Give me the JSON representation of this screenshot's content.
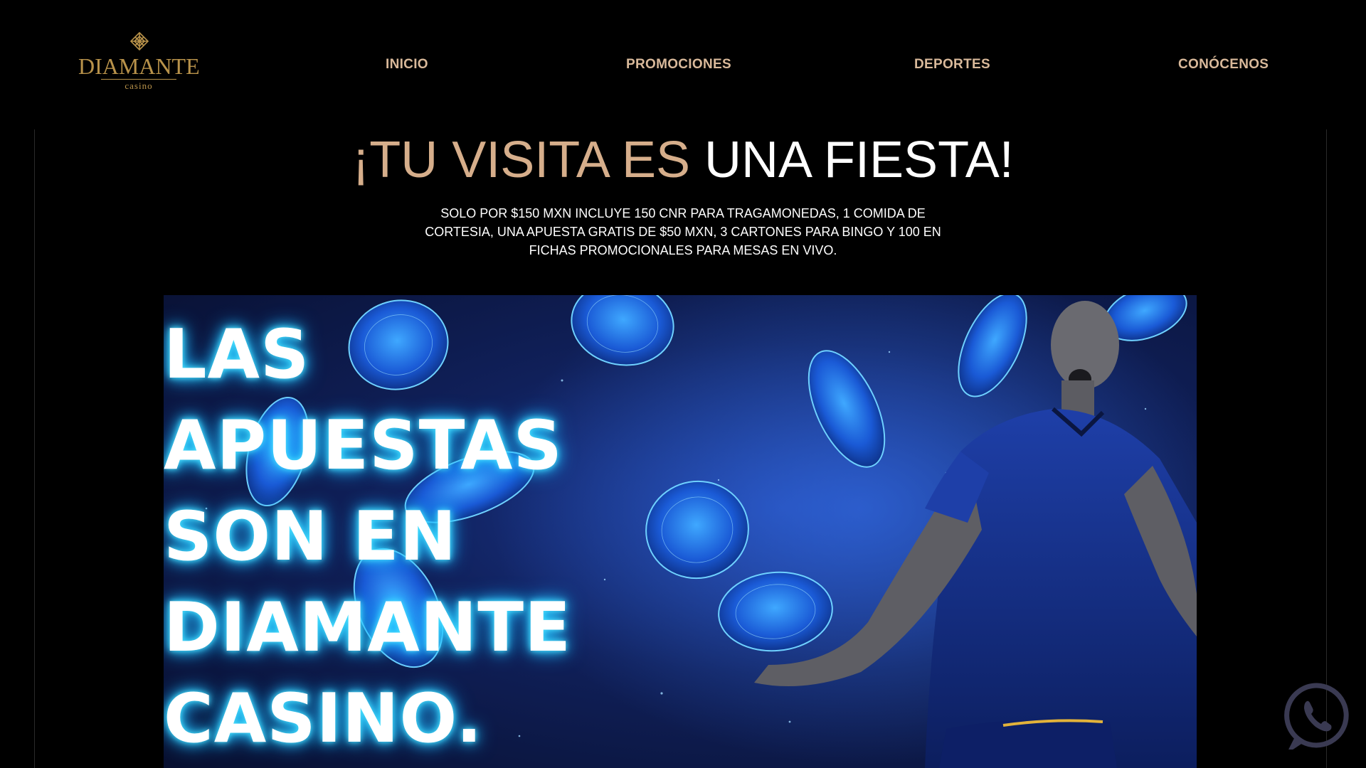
{
  "brand": {
    "name": "DIAMANTE",
    "sub": "casino",
    "gold": "#b8924a"
  },
  "nav": {
    "items": [
      {
        "label": "INICIO"
      },
      {
        "label": "PROMOCIONES"
      },
      {
        "label": "DEPORTES"
      },
      {
        "label": "CONÓCENOS"
      }
    ],
    "color": "#d9b99a"
  },
  "hero": {
    "title_gold": "¡TU VISITA ES",
    "title_white": "UNA FIESTA!",
    "description": "SOLO POR $150 MXN INCLUYE 150 CNR PARA TRAGAMONEDAS, 1 COMIDA DE CORTESIA, UNA APUESTA GRATIS DE $50 MXN, 3 CARTONES PARA BINGO Y 100 EN FICHAS PROMOCIONALES PARA MESAS EN VIVO."
  },
  "banner": {
    "headline_lines": [
      "LAS",
      "APUESTAS",
      "SON EN",
      "DIAMANTE",
      "CASINO."
    ],
    "glow_color": "#2ad0ff"
  },
  "floating": {
    "icon": "whatsapp-icon"
  }
}
